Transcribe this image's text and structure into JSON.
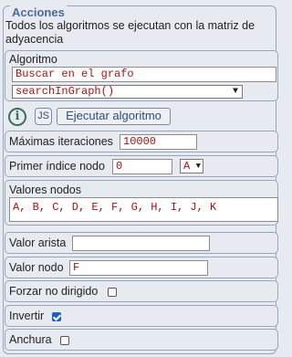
{
  "panel": {
    "legend": "Acciones",
    "description": "Todos los algoritmos se ejecutan con la matriz de adyacencia"
  },
  "algoritmo": {
    "label": "Algoritmo",
    "search_value": "Buscar en el grafo",
    "select_value": "searchInGraph()"
  },
  "toolbar": {
    "info_icon": "info-icon",
    "js_label": "JS",
    "run_label": "Ejecutar algoritmo"
  },
  "max_iter": {
    "label": "Máximas iteraciones",
    "value": "10000"
  },
  "primer_indice": {
    "label": "Primer índice nodo",
    "value": "0",
    "select": "A"
  },
  "valores_nodos": {
    "label": "Valores nodos",
    "value": "A, B, C, D, E, F, G, H, I, J, K"
  },
  "valor_arista": {
    "label": "Valor arista",
    "value": ""
  },
  "valor_nodo": {
    "label": "Valor nodo",
    "value": "F"
  },
  "forzar": {
    "label": "Forzar no dirigido",
    "checked": false
  },
  "invertir": {
    "label": "Invertir",
    "checked": true
  },
  "anchura": {
    "label": "Anchura",
    "checked": false
  }
}
